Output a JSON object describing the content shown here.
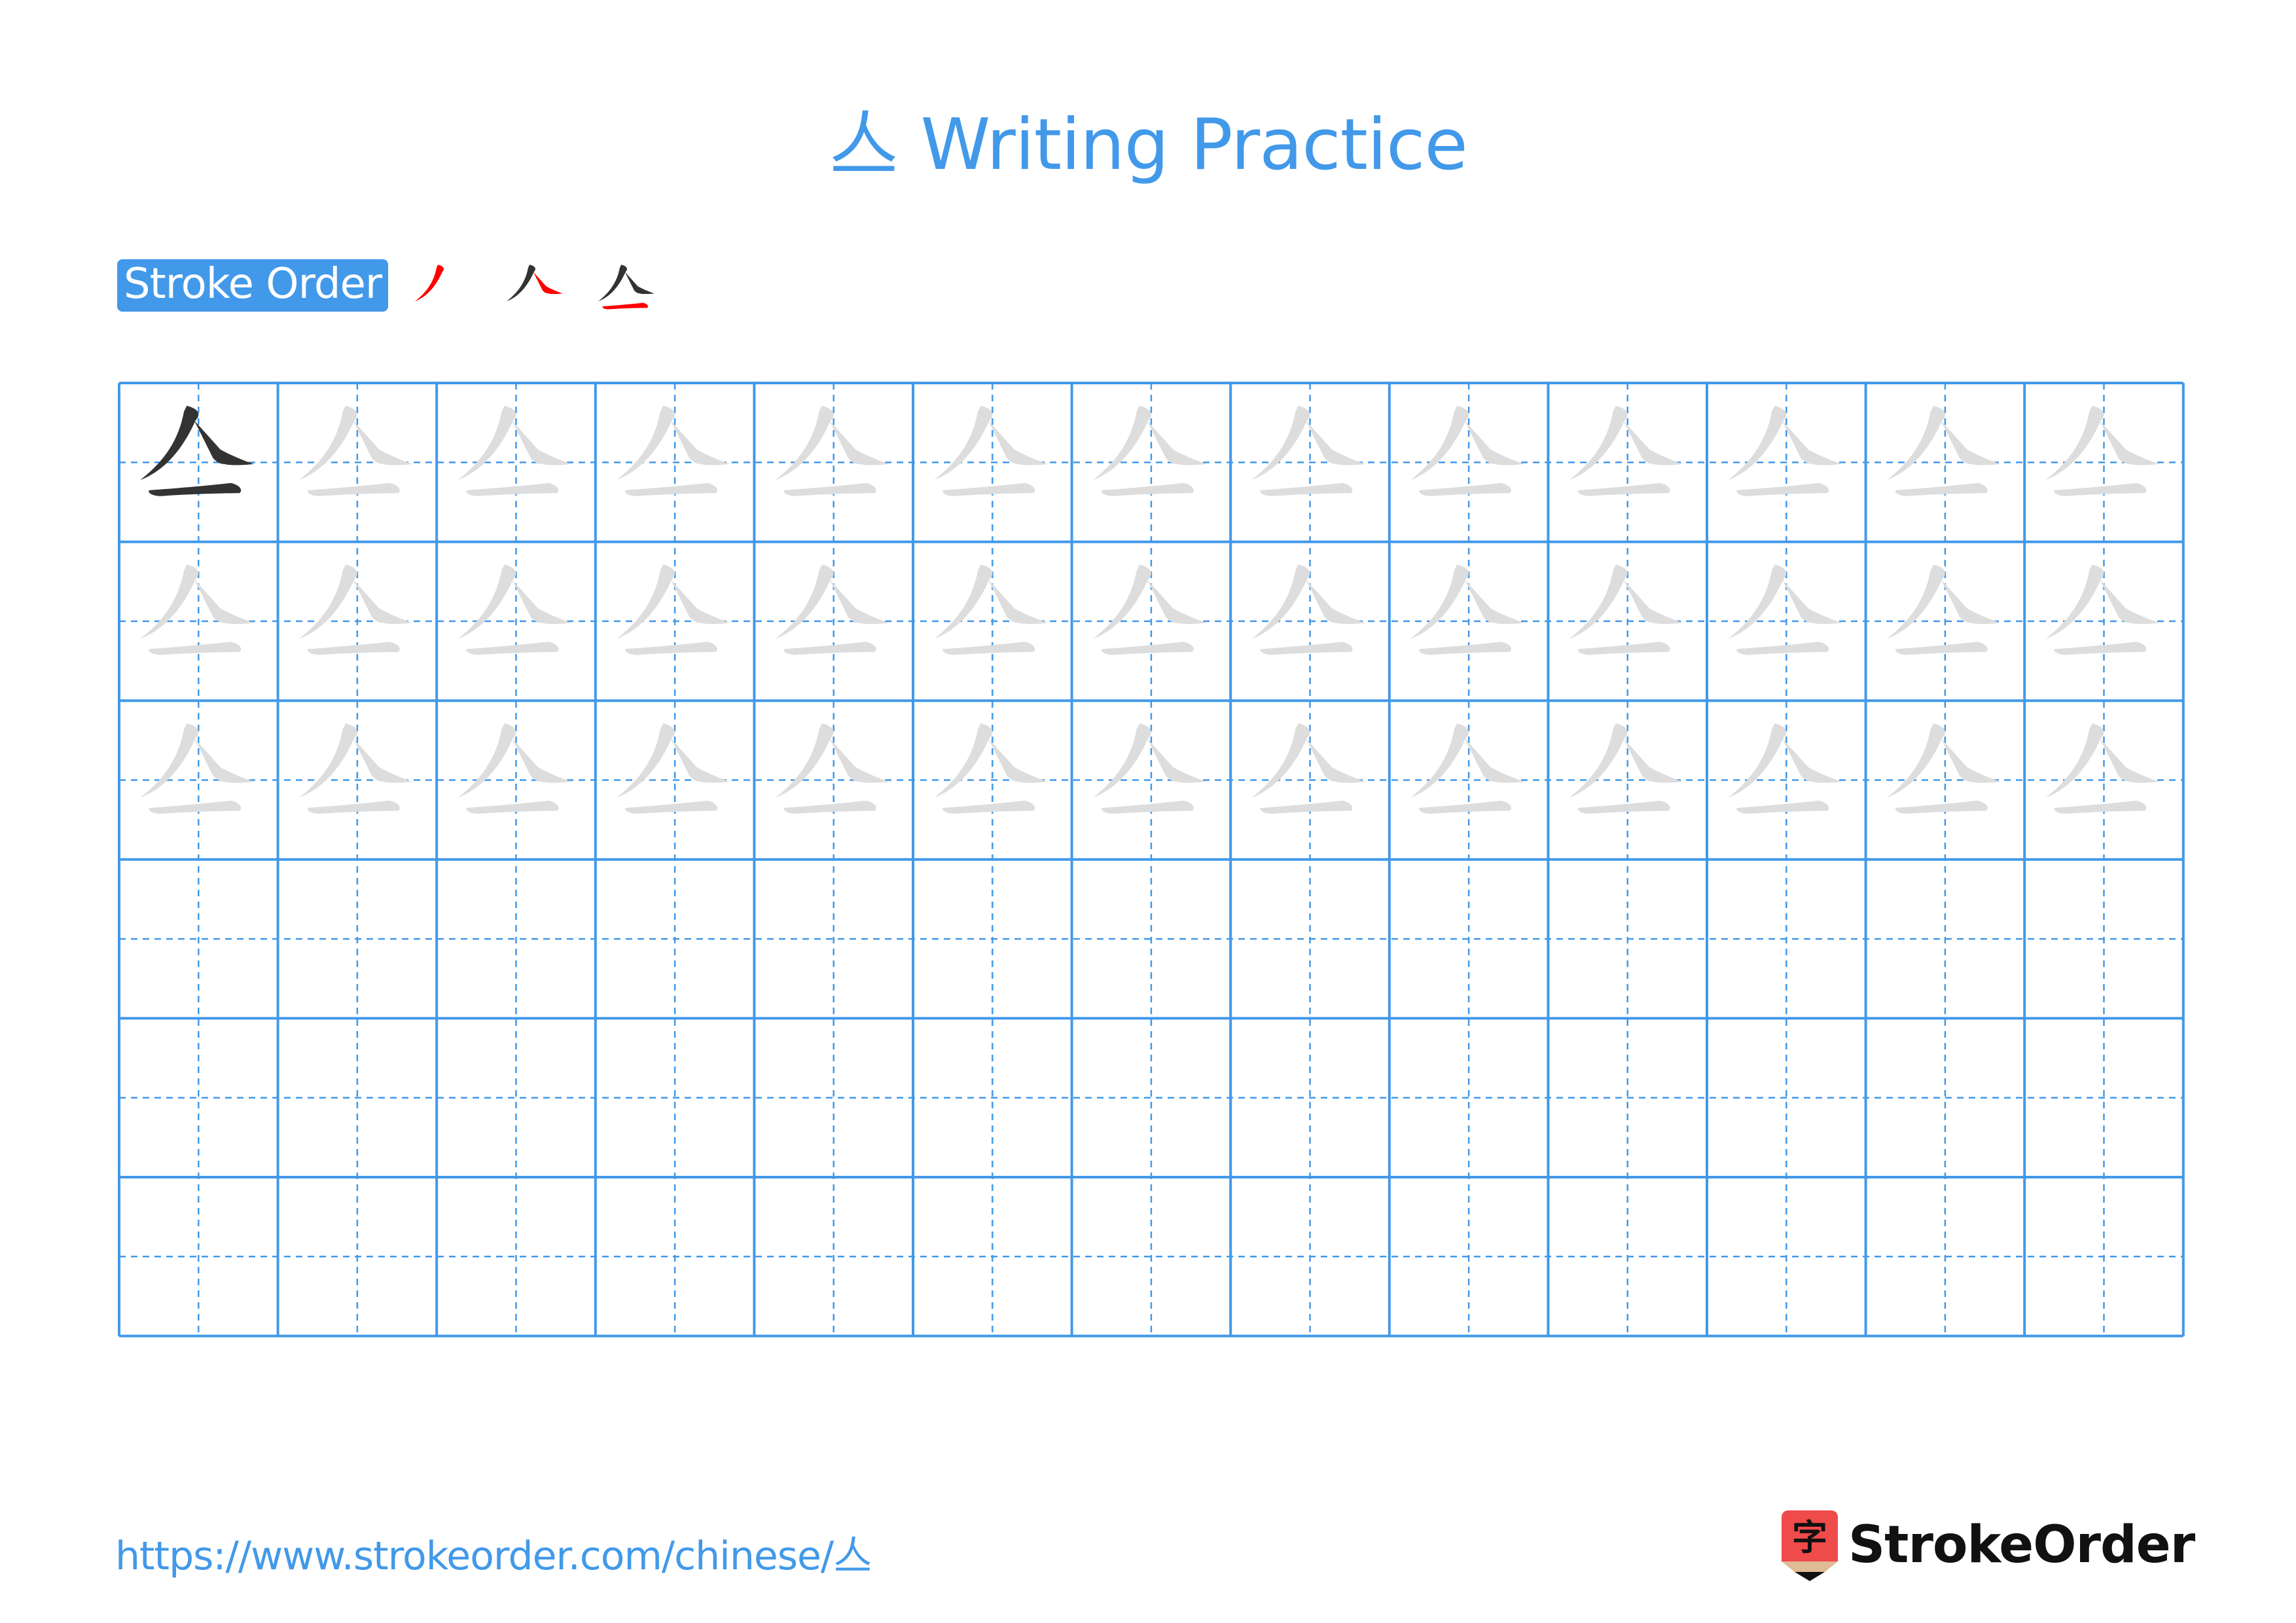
{
  "header": {
    "title": "亼 Writing Practice"
  },
  "stroke_order": {
    "label": "Stroke Order",
    "character": "亼",
    "steps": [
      {
        "step": 1,
        "highlight_stroke": 1
      },
      {
        "step": 2,
        "highlight_stroke": 2
      },
      {
        "step": 3,
        "highlight_stroke": 3
      }
    ]
  },
  "grid": {
    "character": "亼",
    "columns": 13,
    "rows": 6,
    "model_cells": 1,
    "trace_rows": 3,
    "blank_rows": 3
  },
  "colors": {
    "accent": "#4299e9",
    "stroke_dark": "#333333",
    "stroke_highlight": "#ff0000",
    "trace_gray": "#dddddd",
    "logo_red": "#ef4b4b",
    "logo_tan": "#dfbc96"
  },
  "footer": {
    "url": "https://www.strokeorder.com/chinese/亼",
    "brand": "StrokeOrder",
    "brand_icon_char": "字"
  }
}
